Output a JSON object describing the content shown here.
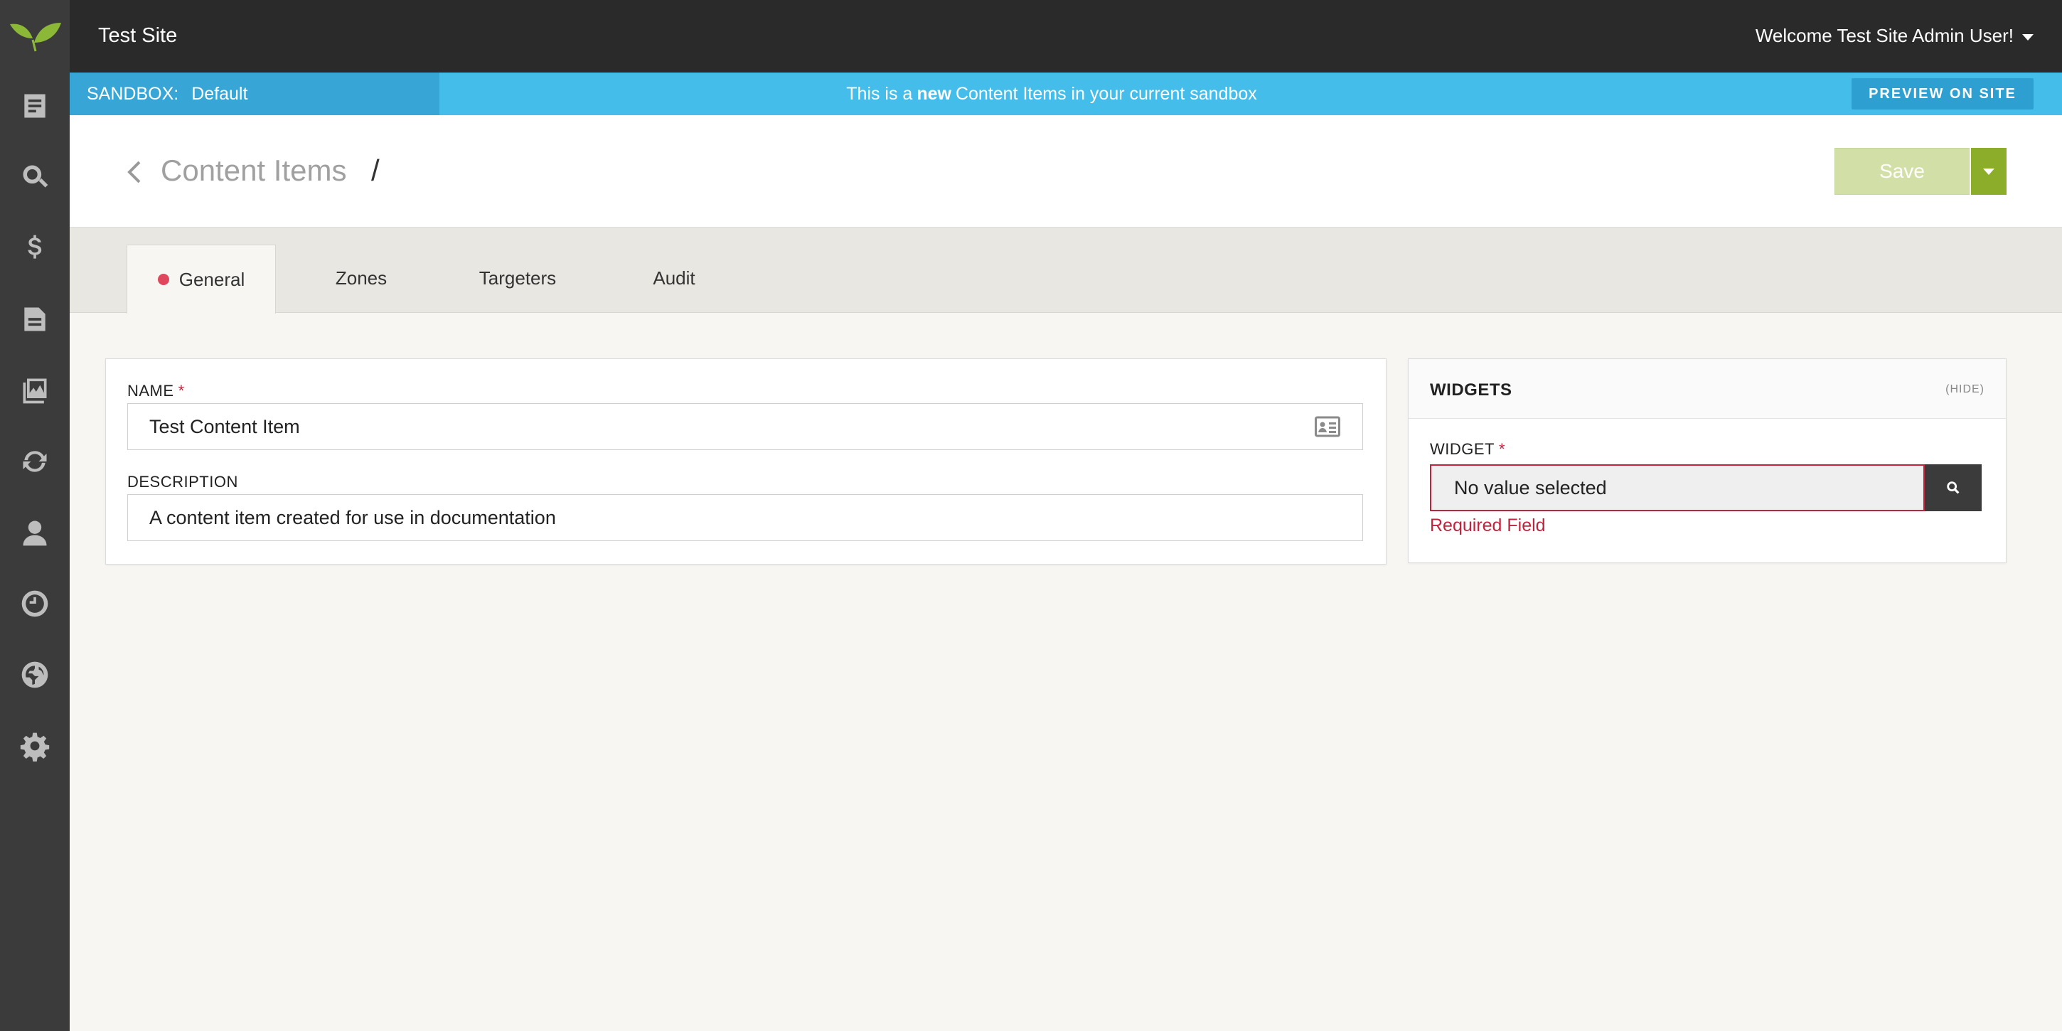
{
  "app": {
    "site_title": "Test Site",
    "welcome": "Welcome Test Site Admin User!"
  },
  "sandbox": {
    "label": "SANDBOX:",
    "name": "Default",
    "message_prefix": "This is a",
    "message_bold": "new",
    "message_suffix": "Content Items in your current sandbox",
    "preview_button": "PREVIEW ON SITE"
  },
  "rail": {
    "icons": [
      "logo-leaf-icon",
      "document-icon",
      "search-icon",
      "dollar-icon",
      "file-icon",
      "gallery-icon",
      "refresh-icon",
      "user-icon",
      "clock-icon",
      "globe-icon",
      "gear-icon"
    ]
  },
  "header": {
    "title": "Content Items",
    "slash": "/",
    "save_label": "Save"
  },
  "tabs": [
    {
      "label": "General",
      "active": true,
      "has_error": true
    },
    {
      "label": "Zones",
      "active": false
    },
    {
      "label": "Targeters",
      "active": false
    },
    {
      "label": "Audit",
      "active": false
    }
  ],
  "form": {
    "name_label": "NAME",
    "required_mark": "*",
    "name_value": "Test Content Item",
    "description_label": "DESCRIPTION",
    "description_value": "A content item created for use in documentation"
  },
  "widgets": {
    "title": "WIDGETS",
    "hide_label": "(HIDE)",
    "widget_label": "WIDGET",
    "required_mark": "*",
    "selected_value": "No value selected",
    "error_message": "Required Field"
  },
  "colors": {
    "rail_bg": "#3b3b3b",
    "topbar_bg": "#2a2a2a",
    "sandbox_bg": "#45bdea",
    "save_disabled": "#d2e0a8",
    "save_accent": "#8cad2a",
    "error": "#c0243c",
    "tab_error_dot": "#e0475c"
  }
}
